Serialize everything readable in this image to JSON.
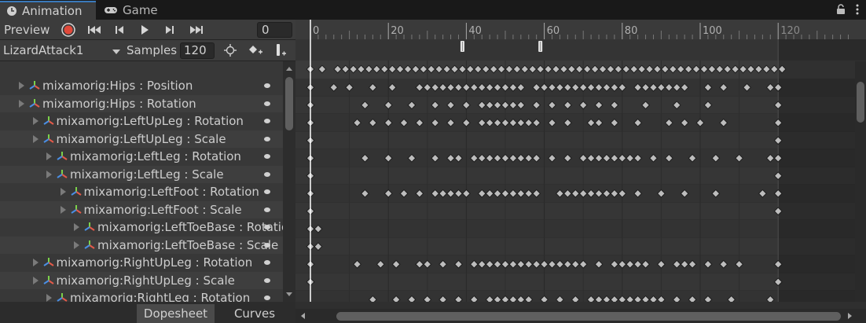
{
  "tabs": [
    {
      "label": "Animation",
      "icon": "clock-icon",
      "active": true
    },
    {
      "label": "Game",
      "icon": "gamepad-icon",
      "active": false
    }
  ],
  "toolbar": {
    "preview_label": "Preview",
    "frame_value": "0",
    "clip_name": "LizardAttack1",
    "samples_label": "Samples",
    "samples_value": "120"
  },
  "timeline": {
    "ruler_labels": [
      "0",
      "20",
      "40",
      "60",
      "80",
      "100",
      "120"
    ],
    "max_frame": 120,
    "events": [
      39,
      59
    ]
  },
  "properties": [
    {
      "label": "mixamorig:Hips : Position",
      "indent": 0,
      "keys": [
        0,
        6,
        10,
        16,
        21,
        28,
        30,
        32,
        34,
        36,
        38,
        40,
        42,
        44,
        46,
        48,
        50,
        52,
        54,
        58,
        60,
        62,
        64,
        66,
        68,
        70,
        72,
        74,
        76,
        78,
        80,
        84,
        86,
        88,
        90,
        92,
        94,
        96,
        102,
        106,
        112,
        118,
        120
      ]
    },
    {
      "label": "mixamorig:Hips : Rotation",
      "indent": 0,
      "keys": [
        0,
        14,
        20,
        26,
        32,
        36,
        40,
        44,
        46,
        48,
        50,
        52,
        54,
        58,
        62,
        66,
        70,
        74,
        78,
        86,
        94,
        102,
        120
      ]
    },
    {
      "label": "mixamorig:LeftUpLeg : Rotation",
      "indent": 1,
      "keys": [
        0,
        12,
        16,
        20,
        24,
        28,
        32,
        36,
        40,
        44,
        46,
        48,
        50,
        52,
        54,
        56,
        58,
        62,
        66,
        72,
        74,
        78,
        84,
        92,
        96,
        100,
        106,
        120
      ]
    },
    {
      "label": "mixamorig:LeftUpLeg : Scale",
      "indent": 1,
      "keys": [
        0,
        120
      ]
    },
    {
      "label": "mixamorig:LeftLeg : Rotation",
      "indent": 2,
      "keys": [
        0,
        14,
        20,
        26,
        32,
        36,
        38,
        42,
        44,
        46,
        48,
        50,
        52,
        54,
        56,
        58,
        62,
        66,
        70,
        72,
        74,
        76,
        78,
        80,
        82,
        84,
        88,
        92,
        98,
        104,
        110,
        118,
        120
      ]
    },
    {
      "label": "mixamorig:LeftLeg : Scale",
      "indent": 2,
      "keys": [
        0,
        120
      ]
    },
    {
      "label": "mixamorig:LeftFoot : Rotation",
      "indent": 3,
      "keys": [
        0,
        14,
        20,
        24,
        28,
        32,
        34,
        36,
        38,
        40,
        44,
        46,
        48,
        50,
        52,
        54,
        56,
        58,
        64,
        66,
        68,
        70,
        72,
        74,
        76,
        78,
        80,
        84,
        90,
        96,
        104,
        116,
        120
      ]
    },
    {
      "label": "mixamorig:LeftFoot : Scale",
      "indent": 3,
      "keys": [
        0,
        120
      ]
    },
    {
      "label": "mixamorig:LeftToeBase : Rotation",
      "indent": 4,
      "keys": [
        0,
        2
      ]
    },
    {
      "label": "mixamorig:LeftToeBase : Scale",
      "indent": 4,
      "keys": [
        0,
        2
      ]
    },
    {
      "label": "mixamorig:RightUpLeg : Rotation",
      "indent": 1,
      "keys": [
        0,
        12,
        18,
        22,
        28,
        30,
        34,
        38,
        42,
        44,
        46,
        48,
        50,
        52,
        54,
        56,
        58,
        60,
        62,
        64,
        66,
        68,
        70,
        74,
        78,
        80,
        82,
        84,
        86,
        90,
        94,
        96,
        98,
        102,
        106,
        110,
        120
      ]
    },
    {
      "label": "mixamorig:RightUpLeg : Scale",
      "indent": 1,
      "keys": [
        0,
        120
      ]
    },
    {
      "label": "mixamorig:RightLeg : Rotation",
      "indent": 2,
      "keys": [
        16,
        22,
        26,
        30,
        34,
        38,
        42,
        46,
        48,
        50,
        52,
        54,
        56,
        60,
        64,
        68,
        72,
        74,
        76,
        78,
        80,
        82,
        84,
        86,
        88,
        90,
        94,
        98,
        102,
        108,
        118
      ]
    }
  ],
  "summary_keys": [
    0,
    2,
    6,
    8,
    10,
    12,
    14,
    16,
    18,
    20,
    22,
    24,
    26,
    28,
    30,
    32,
    34,
    36,
    38,
    40,
    42,
    44,
    46,
    48,
    50,
    52,
    54,
    56,
    58,
    60,
    62,
    64,
    66,
    68,
    70,
    72,
    74,
    76,
    78,
    80,
    82,
    84,
    86,
    88,
    90,
    92,
    94,
    96,
    98,
    100,
    102,
    104,
    106,
    108,
    110,
    112,
    114,
    116,
    118,
    120
  ],
  "bottom_tabs": [
    {
      "label": "Dopesheet",
      "active": true
    },
    {
      "label": "Curves",
      "active": false
    }
  ],
  "colors": {
    "accent": "#3a79bb",
    "record": "#e0493a",
    "keyframe": "#bdbdbd",
    "playhead": "#ffffff"
  }
}
